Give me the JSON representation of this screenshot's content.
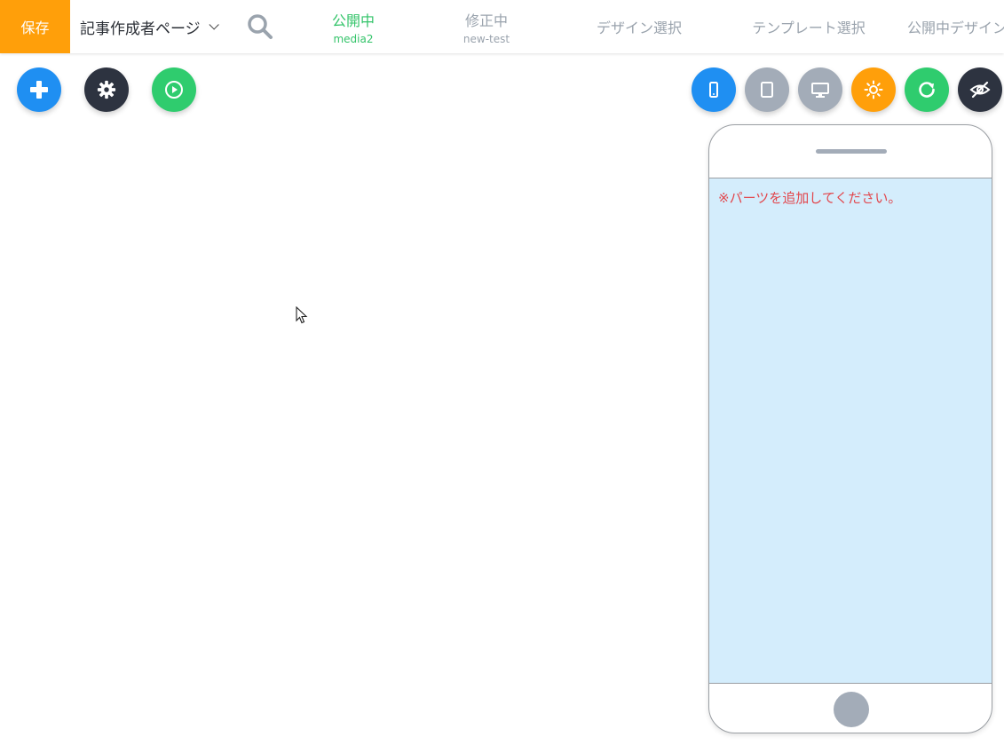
{
  "colors": {
    "save": "#ff9f0a",
    "blue": "#1f8ff2",
    "dark": "#2d3340",
    "green": "#2fcc6e",
    "grey": "#a3acb8",
    "orange": "#ff9f0a",
    "published_tab": "#34c46a",
    "inactive_tab": "#9aa3ad",
    "phone_screen": "#d4edfc",
    "warning_text": "#e2474d"
  },
  "header": {
    "save_label": "保存",
    "page_select": "記事作成者ページ",
    "tabs": [
      {
        "label": "公開中",
        "sub": "media2",
        "active": true
      },
      {
        "label": "修正中",
        "sub": "new-test",
        "active": false
      },
      {
        "label": "デザイン選択"
      },
      {
        "label": "テンプレート選択"
      },
      {
        "label": "公開中デザイン"
      }
    ]
  },
  "toolbar_left": {
    "icons": [
      "plus-icon",
      "gear-icon",
      "play-circle-icon"
    ]
  },
  "toolbar_right": {
    "icons": [
      "smartphone-icon",
      "tablet-icon",
      "desktop-icon",
      "sun-icon",
      "refresh-icon",
      "eye-off-icon"
    ],
    "selected_device": "smartphone"
  },
  "preview": {
    "placeholder": "※パーツを追加してください。"
  }
}
